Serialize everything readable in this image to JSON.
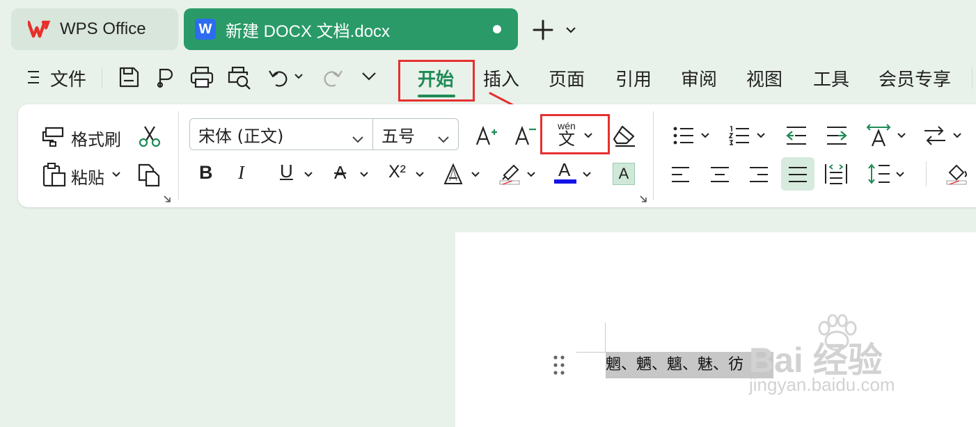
{
  "tabs": {
    "wps": {
      "title": "WPS Office"
    },
    "doc": {
      "icon_letter": "W",
      "title": "新建 DOCX 文档.docx"
    },
    "new_tab": "+"
  },
  "menu": {
    "file": "文件",
    "items": [
      "开始",
      "插入",
      "页面",
      "引用",
      "审阅",
      "视图",
      "工具",
      "会员专享"
    ],
    "active": "开始"
  },
  "ribbon": {
    "clipboard": {
      "format_painter": "格式刷",
      "paste": "粘贴"
    },
    "font": {
      "font_name": "宋体 (正文)",
      "font_size": "五号",
      "bold": "B",
      "italic": "I",
      "underline": "U",
      "strike": "A",
      "superscript": "X²",
      "text_effect": "A",
      "font_color": "A",
      "char_shading": "A",
      "grow": "A⁺",
      "shrink": "A⁻",
      "pinyin_top": "wén",
      "pinyin_char": "文"
    }
  },
  "colors": {
    "accent": "#1f8a55",
    "tab_active": "#2a9a68",
    "highlight_red": "#e53030",
    "font_color_bar": "#1414e6",
    "selection": "#c7c7c7"
  },
  "document": {
    "text": "魍、魉、魑、魅、彷"
  },
  "watermark": {
    "brand": "Bai 经验",
    "url": "jingyan.baidu.com"
  }
}
